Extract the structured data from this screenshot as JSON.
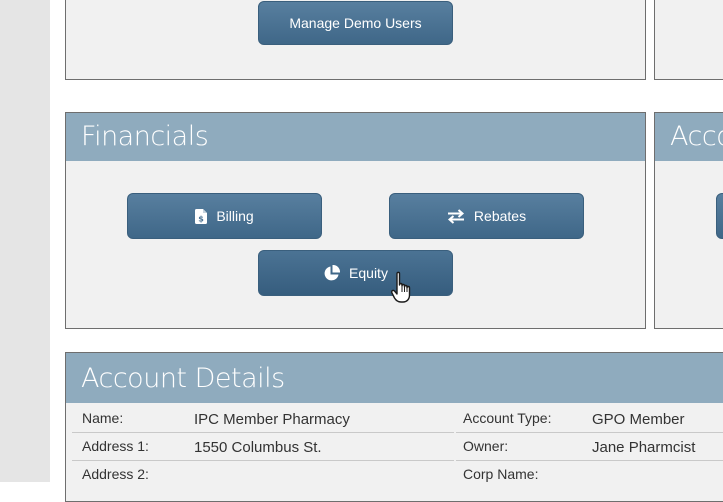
{
  "top_panel": {
    "manage_demo_users_label": "Manage Demo Users"
  },
  "financials": {
    "title": "Financials",
    "billing_label": "Billing",
    "rebates_label": "Rebates",
    "equity_label": "Equity"
  },
  "right_panel": {
    "title_fragment": "Acco"
  },
  "account_details": {
    "title": "Account Details",
    "left_fields": [
      {
        "label": "Name:",
        "value": "IPC Member Pharmacy"
      },
      {
        "label": "Address 1:",
        "value": "1550 Columbus St."
      },
      {
        "label": "Address 2:",
        "value": ""
      }
    ],
    "right_fields": [
      {
        "label": "Account Type:",
        "value": "GPO Member"
      },
      {
        "label": "Owner:",
        "value": "Jane Pharmcist"
      },
      {
        "label": "Corp Name:",
        "value": ""
      }
    ]
  },
  "icons": {
    "billing": "invoice-dollar-icon",
    "rebates": "exchange-arrows-icon",
    "equity": "pie-chart-icon",
    "cursor": "hand-pointer-cursor"
  },
  "colors": {
    "header": "#8fabbe",
    "button": "#4a7293",
    "panel": "#f1f1f1"
  }
}
